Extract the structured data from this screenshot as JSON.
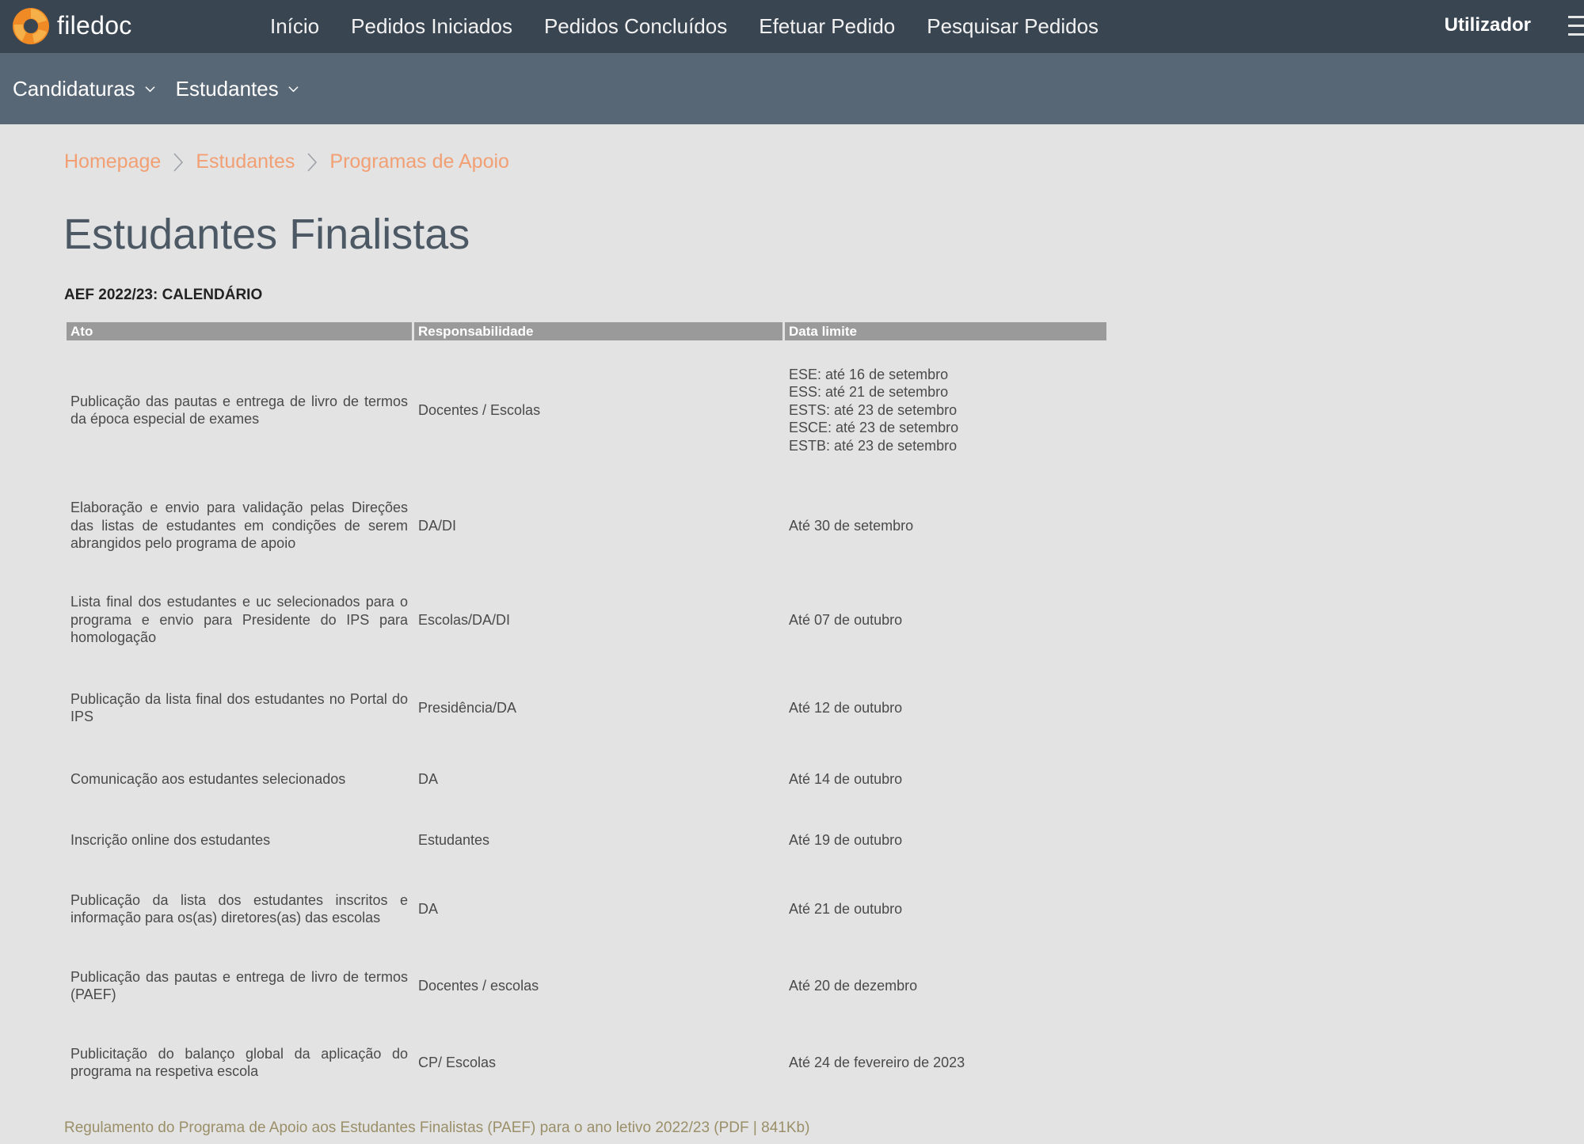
{
  "brand": {
    "name": "filedoc"
  },
  "top_nav": {
    "items": [
      {
        "label": "Início"
      },
      {
        "label": "Pedidos Iniciados"
      },
      {
        "label": "Pedidos Concluídos"
      },
      {
        "label": "Efetuar Pedido"
      },
      {
        "label": "Pesquisar Pedidos"
      }
    ],
    "user_label": "Utilizador"
  },
  "sub_nav": {
    "items": [
      {
        "label": "Candidaturas"
      },
      {
        "label": "Estudantes"
      }
    ]
  },
  "breadcrumb": [
    "Homepage",
    "Estudantes",
    "Programas de Apoio"
  ],
  "page": {
    "title": "Estudantes Finalistas",
    "section_title": "AEF 2022/23: CALENDÁRIO",
    "footer_link": "Regulamento do Programa de Apoio aos Estudantes Finalistas (PAEF) para o ano letivo 2022/23 (PDF | 841Kb)"
  },
  "table": {
    "headers": [
      "Ato",
      "Responsabilidade",
      "Data limite"
    ],
    "rows": [
      {
        "ato": "Publicação das pautas e entrega de livro de termos da época especial de exames",
        "resp": "Docentes / Escolas",
        "data": [
          "ESE: até 16 de setembro",
          "ESS: até 21 de setembro",
          "ESTS: até 23 de setembro",
          "ESCE: até 23 de setembro",
          "ESTB: até 23 de setembro"
        ]
      },
      {
        "ato": "Elaboração e envio para validação pelas Direções das listas de estudantes em condições de serem abrangidos pelo programa de apoio",
        "resp": "DA/DI",
        "data": [
          "Até 30 de setembro"
        ]
      },
      {
        "ato": "Lista final dos estudantes e uc selecionados para o programa e envio para Presidente do IPS para homologação",
        "resp": "Escolas/DA/DI",
        "data": [
          "Até 07 de outubro"
        ]
      },
      {
        "ato": "Publicação da lista final dos estudantes no Portal do IPS",
        "resp": "Presidência/DA",
        "data": [
          "Até 12 de outubro"
        ]
      },
      {
        "ato": "Comunicação aos estudantes selecionados",
        "resp": "DA",
        "data": [
          "Até 14 de outubro"
        ]
      },
      {
        "ato": "Inscrição online dos estudantes",
        "resp": "Estudantes",
        "data": [
          "Até 19 de outubro"
        ]
      },
      {
        "ato": "Publicação da lista dos estudantes inscritos e informação para os(as) diretores(as) das escolas",
        "resp": "DA",
        "data": [
          "Até 21 de outubro"
        ]
      },
      {
        "ato": "Publicação das pautas e entrega de livro de termos (PAEF)",
        "resp": "Docentes / escolas",
        "data": [
          "Até 20 de dezembro"
        ]
      },
      {
        "ato": "Publicitação do balanço global da aplicação do programa na respetiva escola",
        "resp": "CP/ Escolas",
        "data": [
          "Até 24 de fevereiro de 2023"
        ]
      }
    ]
  },
  "colors": {
    "topbar": "#3a4552",
    "subbar": "#586776",
    "background": "#e3e3e3",
    "breadcrumb": "#f29f73",
    "table_header": "#9a9a9a",
    "logo_orange": "#f08a24"
  },
  "icons": [
    "filedoc-logo-icon",
    "chevron-down-icon",
    "chevron-right-icon",
    "hamburger-menu-icon"
  ]
}
